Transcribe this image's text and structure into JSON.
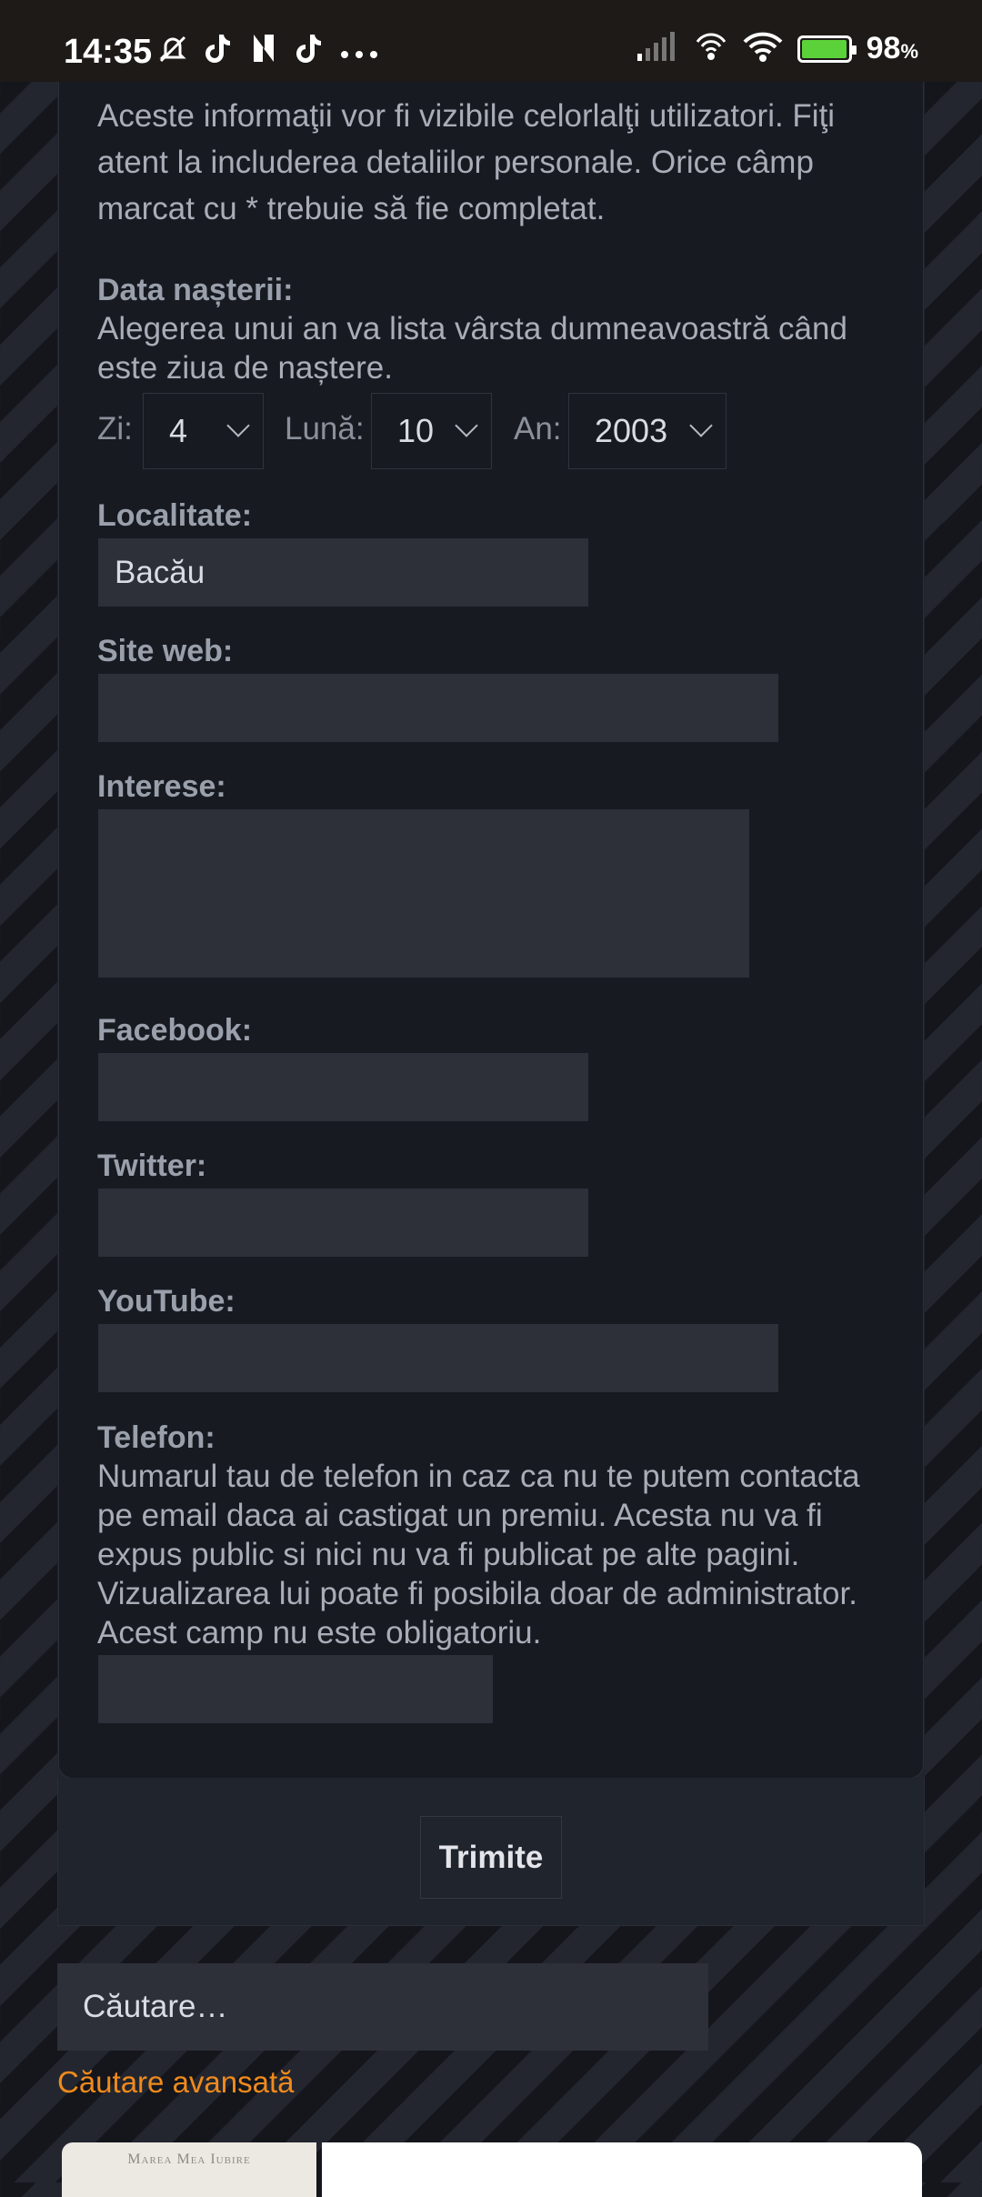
{
  "status_bar": {
    "time": "14:35",
    "battery_percent": "98",
    "battery_unit": "%",
    "icons_left": [
      "mute-icon",
      "tiktok-icon",
      "n-icon",
      "tiktok-icon",
      "more-icon"
    ],
    "icons_right": [
      "signal-icon",
      "hotspot-icon",
      "wifi-icon",
      "battery-icon"
    ]
  },
  "form": {
    "intro": "Aceste informaţii vor fi vizibile celorlalţi utilizatori. Fiţi atent la includerea detaliilor personale. Orice câmp marcat cu * trebuie să fie completat.",
    "birthdate": {
      "label": "Data nașterii:",
      "help": "Alegerea unui an va lista vârsta dumneavoastră când este ziua de naștere.",
      "day_label": "Zi:",
      "day_value": "4",
      "month_label": "Lună:",
      "month_value": "10",
      "year_label": "An:",
      "year_value": "2003"
    },
    "location": {
      "label": "Localitate:",
      "value": "Bacău"
    },
    "website": {
      "label": "Site web:",
      "value": ""
    },
    "interests": {
      "label": "Interese:",
      "value": ""
    },
    "facebook": {
      "label": "Facebook:",
      "value": ""
    },
    "twitter": {
      "label": "Twitter:",
      "value": ""
    },
    "youtube": {
      "label": "YouTube:",
      "value": ""
    },
    "phone": {
      "label": "Telefon:",
      "help": "Numarul tau de telefon in caz ca nu te putem contacta pe email daca ai castigat un premiu. Acesta nu va fi expus public si nici nu va fi publicat pe alte pagini. Vizualizarea lui poate fi posibila doar de administrator. Acest camp nu este obligatoriu.",
      "value": ""
    },
    "submit_label": "Trimite"
  },
  "search": {
    "placeholder": "Căutare…",
    "advanced_link": "Căutare avansată"
  },
  "bottom_card": {
    "logo_text": "Marea Mea Iubire"
  },
  "colors": {
    "accent_link": "#f08a1c",
    "panel_bg": "#171a21",
    "input_bg": "#2d3039"
  }
}
